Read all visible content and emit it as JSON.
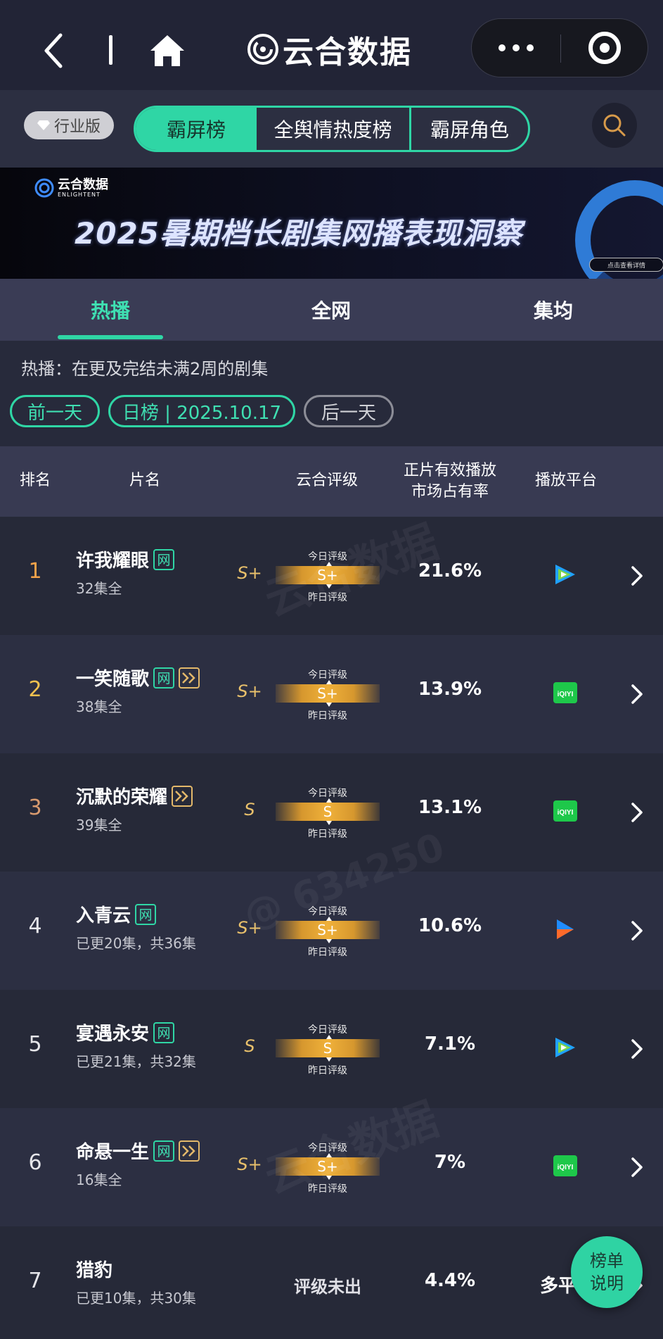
{
  "nav": {
    "title": "云合数据",
    "icons": [
      "back-icon",
      "home-icon",
      "more-icon",
      "close-mini-program-icon"
    ]
  },
  "board_selector": {
    "industry_label": "行业版",
    "tabs": [
      "霸屏榜",
      "全舆情热度榜",
      "霸屏角色"
    ],
    "active_tab": "霸屏榜"
  },
  "banner": {
    "logo_text": "云合数据",
    "logo_sub": "ENLIGHTENT",
    "title": "2025暑期档长剧集网播表现洞察",
    "detail_button": "点击查看详情"
  },
  "sub_tabs": {
    "items": [
      "热播",
      "全网",
      "集均"
    ],
    "active": "热播"
  },
  "hint_text": "热播：在更及完结未满2周的剧集",
  "date_nav": {
    "prev": "前一天",
    "current": "日榜 | 2025.10.17",
    "next": "后一天"
  },
  "table": {
    "headers": {
      "rank": "排名",
      "title": "片名",
      "grade": "云合评级",
      "share": "正片有效播放\n市场占有率",
      "platform": "播放平台"
    },
    "rating_labels": {
      "today": "今日评级",
      "yesterday": "昨日评级"
    },
    "rows": [
      {
        "rank": "1",
        "title": "许我耀眼",
        "tags": [
          "网"
        ],
        "episodes": "32集全",
        "grade_yesterday": "S+",
        "grade_today": "S+",
        "share": "21.6%",
        "platform": "tencent-video"
      },
      {
        "rank": "2",
        "title": "一笑随歌",
        "tags": [
          "网",
          "vip"
        ],
        "episodes": "38集全",
        "grade_yesterday": "S+",
        "grade_today": "S+",
        "share": "13.9%",
        "platform": "iqiyi"
      },
      {
        "rank": "3",
        "title": "沉默的荣耀",
        "tags": [
          "vip"
        ],
        "episodes": "39集全",
        "grade_yesterday": "S",
        "grade_today": "S",
        "share": "13.1%",
        "platform": "iqiyi"
      },
      {
        "rank": "4",
        "title": "入青云",
        "tags": [
          "网"
        ],
        "episodes": "已更20集，共36集",
        "grade_yesterday": "S+",
        "grade_today": "S+",
        "share": "10.6%",
        "platform": "youku"
      },
      {
        "rank": "5",
        "title": "宴遇永安",
        "tags": [
          "网"
        ],
        "episodes": "已更21集，共32集",
        "grade_yesterday": "S",
        "grade_today": "S",
        "share": "7.1%",
        "platform": "tencent-video"
      },
      {
        "rank": "6",
        "title": "命悬一生",
        "tags": [
          "网",
          "vip"
        ],
        "episodes": "16集全",
        "grade_yesterday": "S+",
        "grade_today": "S+",
        "share": "7%",
        "platform": "iqiyi"
      },
      {
        "rank": "7",
        "title": "猎豹",
        "tags": [],
        "episodes": "已更10集，共30集",
        "grade_text": "评级未出",
        "share": "4.4%",
        "platform_text": "多平台"
      }
    ]
  },
  "fab": {
    "line1": "榜单",
    "line2": "说明"
  },
  "watermark": {
    "text": "云合数据",
    "sub": "ENLIGHTENT",
    "id": "@ 634250"
  },
  "colors": {
    "accent": "#2fd6a5",
    "gold": "#e8c06b",
    "rank_top3": [
      "#f3a24a",
      "#f2c14f",
      "#d89a6e"
    ]
  }
}
